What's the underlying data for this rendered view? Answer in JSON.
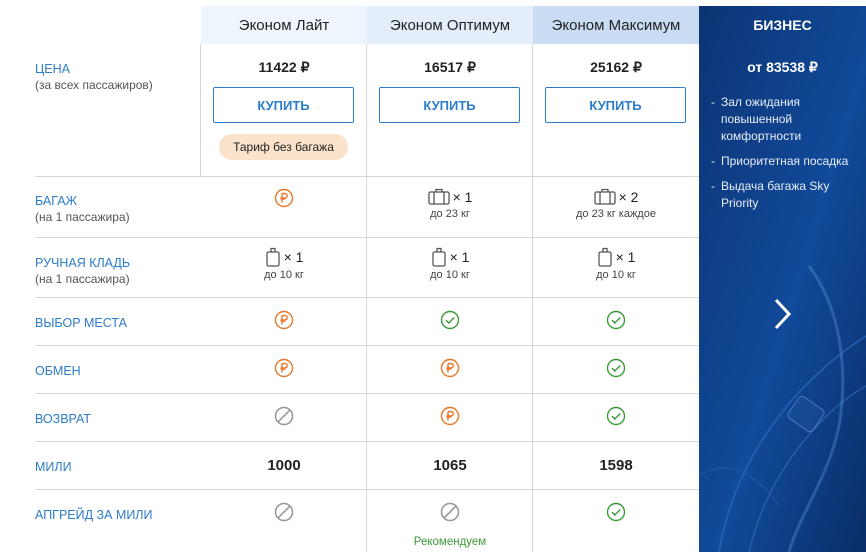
{
  "header": {
    "tariffs": [
      "Эконом Лайт",
      "Эконом Оптимум",
      "Эконом Максимум"
    ],
    "business": "БИЗНЕС"
  },
  "price_row": {
    "label": "ЦЕНА",
    "sub": "(за всех пассажиров)",
    "prices": [
      "11422 ₽",
      "16517 ₽",
      "25162 ₽"
    ],
    "buy_label": "КУПИТЬ",
    "badge": "Тариф без багажа"
  },
  "baggage_row": {
    "label": "БАГАЖ",
    "sub": "(на 1 пассажира)",
    "cells": [
      {
        "icon": "ruble-icon"
      },
      {
        "icon": "suitcase-icon",
        "count": "× 1",
        "note": "до 23 кг"
      },
      {
        "icon": "suitcase-icon",
        "count": "× 2",
        "note": "до 23 кг каждое"
      }
    ]
  },
  "carryon_row": {
    "label": "РУЧНАЯ КЛАДЬ",
    "sub": "(на 1 пассажира)",
    "cells": [
      {
        "icon": "bag-icon",
        "count": "× 1",
        "note": "до 10 кг"
      },
      {
        "icon": "bag-icon",
        "count": "× 1",
        "note": "до 10 кг"
      },
      {
        "icon": "bag-icon",
        "count": "× 1",
        "note": "до 10 кг"
      }
    ]
  },
  "seat_row": {
    "label": "ВЫБОР МЕСТА",
    "icons": [
      "ruble-icon",
      "check-icon",
      "check-icon"
    ]
  },
  "exchange_row": {
    "label": "ОБМЕН",
    "icons": [
      "ruble-icon",
      "ruble-icon",
      "check-icon"
    ]
  },
  "refund_row": {
    "label": "ВОЗВРАТ",
    "icons": [
      "forbidden-icon",
      "ruble-icon",
      "check-icon"
    ]
  },
  "miles_row": {
    "label": "МИЛИ",
    "values": [
      "1000",
      "1065",
      "1598"
    ]
  },
  "upgrade_row": {
    "label": "АПГРЕЙД ЗА МИЛИ",
    "icons": [
      "forbidden-icon",
      "forbidden-icon",
      "check-icon"
    ],
    "recommend": "Рекомендуем"
  },
  "business_panel": {
    "price": "от 83538 ₽",
    "features": [
      "Зал ожидания повышенной комфортности",
      "Приоритетная посадка",
      "Выдача багажа Sky Priority"
    ]
  },
  "colors": {
    "accent": "#2c7cc9",
    "ruble": "#e8782a",
    "check": "#3c9a3c",
    "forbidden": "#999999",
    "business_bg": "#0d3a7a",
    "badge_bg": "#fbe3cb"
  }
}
